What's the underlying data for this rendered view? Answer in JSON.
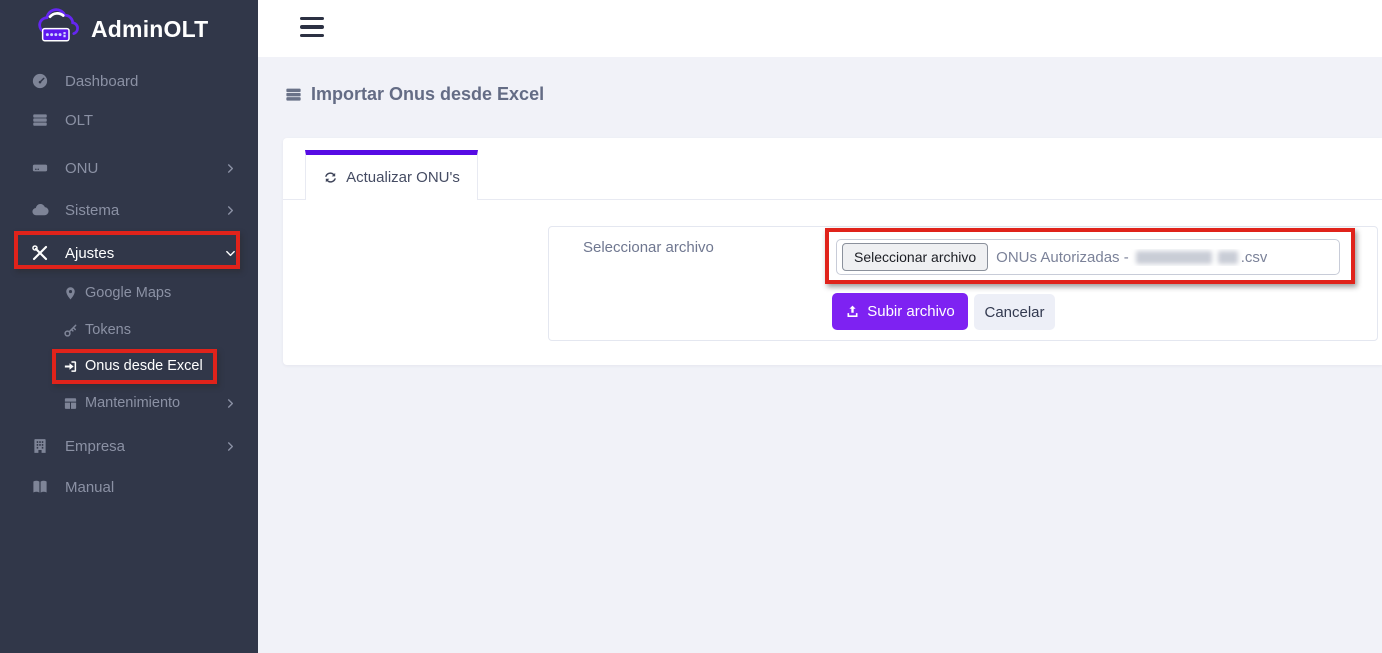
{
  "brand": {
    "name": "AdminOLT"
  },
  "page": {
    "title": "Importar Onus desde Excel"
  },
  "sidebar": {
    "items": [
      {
        "label": "Dashboard"
      },
      {
        "label": "OLT"
      },
      {
        "label": "ONU",
        "chevron": "right"
      },
      {
        "label": "Sistema",
        "chevron": "right"
      },
      {
        "label": "Ajustes",
        "chevron": "down",
        "active": true,
        "annotated": true
      },
      {
        "label": "Google Maps",
        "submenu": true
      },
      {
        "label": "Tokens",
        "submenu": true
      },
      {
        "label": "Onus desde Excel",
        "submenu": true,
        "active": true,
        "annotated": true
      },
      {
        "label": "Mantenimiento",
        "submenu": true,
        "chevron": "right"
      },
      {
        "label": "Empresa",
        "chevron": "right"
      },
      {
        "label": "Manual"
      }
    ]
  },
  "tabs": {
    "active_tab": {
      "label": "Actualizar ONU's"
    }
  },
  "form": {
    "field_label": "Seleccionar archivo",
    "file_input": {
      "button_label": "Seleccionar archivo",
      "filename_prefix": "ONUs Autorizadas -",
      "filename_suffix": ".csv",
      "filename_redacted": true
    },
    "upload_button": "Subir archivo",
    "cancel_button": "Cancelar"
  },
  "colors": {
    "sidebar_bg": "#313749",
    "accent_purple_button": "#7e22f2",
    "tab_accent_purple": "#560be4",
    "annotation_red": "#e0231b",
    "content_bg": "#f1f2f8"
  }
}
